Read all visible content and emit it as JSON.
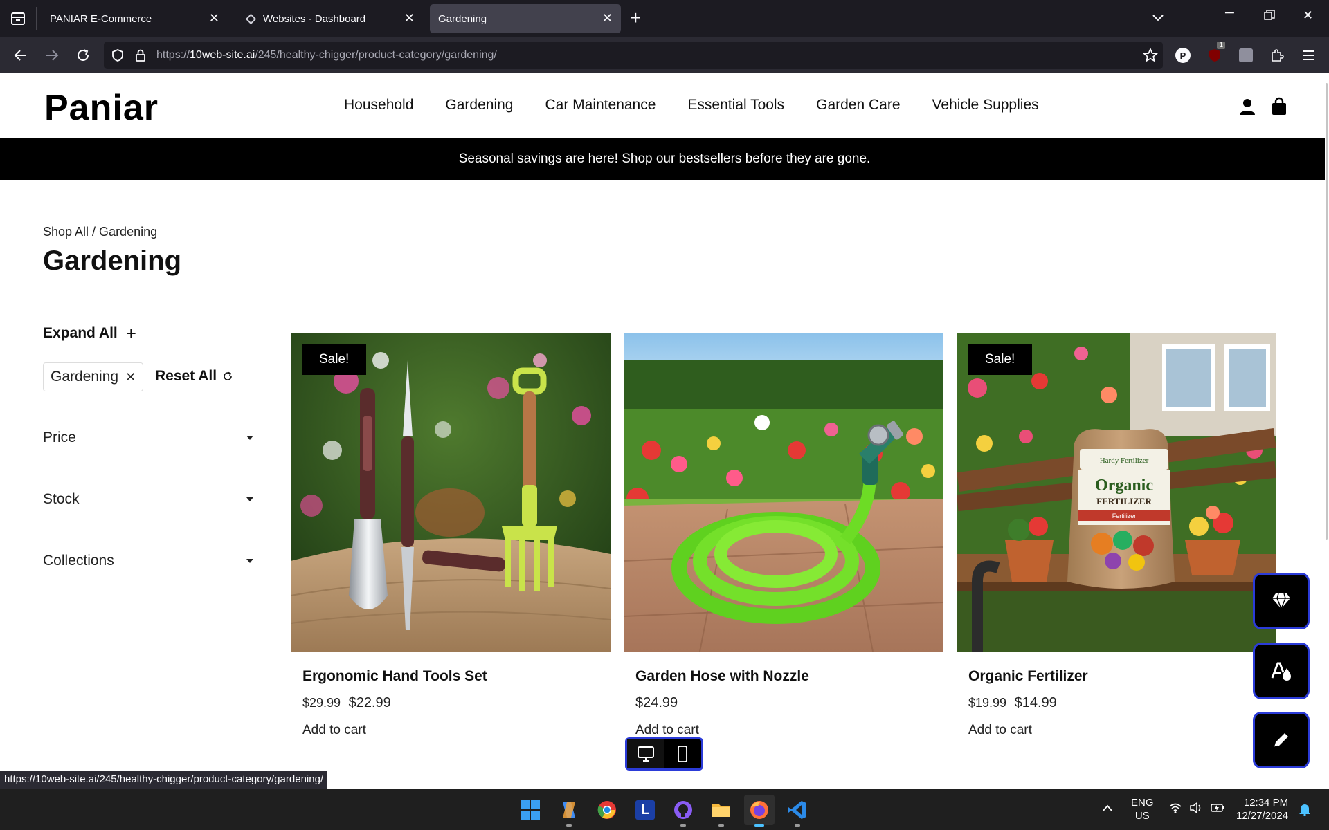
{
  "browser": {
    "tabs": [
      {
        "title": "PANIAR E-Commerce"
      },
      {
        "title": "Websites - Dashboard"
      },
      {
        "title": "Gardening"
      }
    ],
    "url_prefix": "https://",
    "url_domain": "10web-site.ai",
    "url_path": "/245/healthy-chigger/product-category/gardening/",
    "status_url": "https://10web-site.ai/245/healthy-chigger/product-category/gardening/",
    "ext_badge": "1"
  },
  "site": {
    "logo": "Paniar",
    "nav": [
      "Household",
      "Gardening",
      "Car Maintenance",
      "Essential Tools",
      "Garden Care",
      "Vehicle Supplies"
    ],
    "announcement": "Seasonal savings are here! Shop our bestsellers before they are gone.",
    "breadcrumb": "Shop All / Gardening",
    "page_title": "Gardening"
  },
  "filters": {
    "expand_all": "Expand All",
    "active_chip": "Gardening",
    "reset_all": "Reset All",
    "groups": [
      "Price",
      "Stock",
      "Collections"
    ]
  },
  "products": [
    {
      "name": "Ergonomic Hand Tools Set",
      "sale_badge": "Sale!",
      "old_price": "$29.99",
      "price": "$22.99",
      "cta": "Add to cart"
    },
    {
      "name": "Garden Hose with Nozzle",
      "sale_badge": "",
      "old_price": "",
      "price": "$24.99",
      "cta": "Add to cart"
    },
    {
      "name": "Organic Fertilizer",
      "sale_badge": "Sale!",
      "old_price": "$19.99",
      "price": "$14.99",
      "cta": "Add to cart"
    }
  ],
  "product3_bag": {
    "brand": "Hardy Fertilizer",
    "line1": "Organic",
    "line2": "FERTILIZER",
    "band": "Fertilizer"
  },
  "taskbar": {
    "lang": "ENG",
    "region": "US",
    "time": "12:34 PM",
    "date": "12/27/2024"
  },
  "colors": {
    "accent_border": "#2b3bd8",
    "announce_bg": "#000000",
    "chrome_bg": "#1c1b22"
  }
}
